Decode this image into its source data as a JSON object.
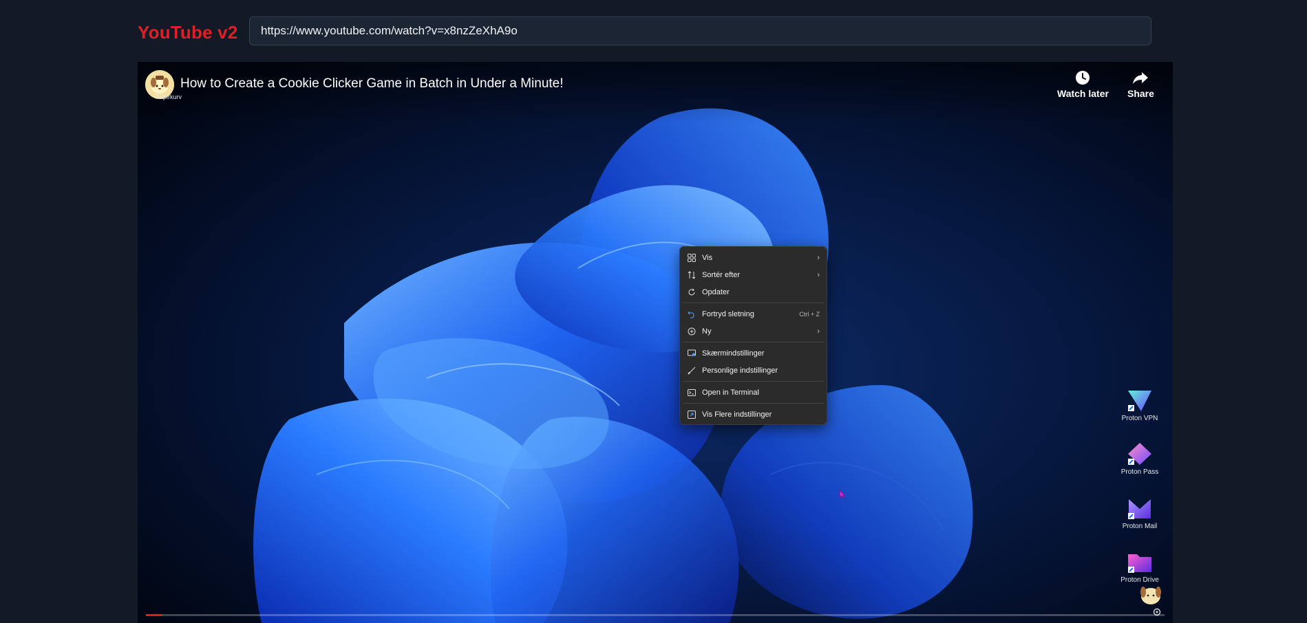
{
  "app": {
    "logo_text": "YouTube v2",
    "brand_color": "#e11d26",
    "url": "https://www.youtube.com/watch?v=x8nzZeXhA9o"
  },
  "video": {
    "title": "How to Create a Cookie Clicker Game in Batch in Under a Minute!",
    "channel_avatar_icon": "pompompurin-avatar-icon",
    "watch_later_label": "Watch later",
    "share_label": "Share",
    "progress_fraction": 0.016
  },
  "desktop": {
    "top_left_label": "Papirkurv",
    "icons": [
      {
        "label": "Proton VPN",
        "icon": "proton-vpn-icon"
      },
      {
        "label": "Proton Pass",
        "icon": "proton-pass-icon"
      },
      {
        "label": "Proton Mail",
        "icon": "proton-mail-icon"
      },
      {
        "label": "Proton Drive",
        "icon": "proton-drive-icon"
      }
    ]
  },
  "context_menu": {
    "items": [
      {
        "label": "Vis",
        "icon": "grid-icon",
        "submenu": true
      },
      {
        "label": "Sortér efter",
        "icon": "sort-icon",
        "submenu": true
      },
      {
        "label": "Opdater",
        "icon": "refresh-icon"
      },
      {
        "label": "Fortryd sletning",
        "icon": "undo-icon",
        "shortcut": "Ctrl + Z"
      },
      {
        "label": "Ny",
        "icon": "plus-circle-icon",
        "submenu": true
      },
      {
        "label": "Skærmindstillinger",
        "icon": "display-icon"
      },
      {
        "label": "Personlige indstillinger",
        "icon": "brush-icon"
      },
      {
        "label": "Open in Terminal",
        "icon": "terminal-icon"
      },
      {
        "label": "Vis Flere indstillinger",
        "icon": "more-options-icon"
      }
    ]
  }
}
